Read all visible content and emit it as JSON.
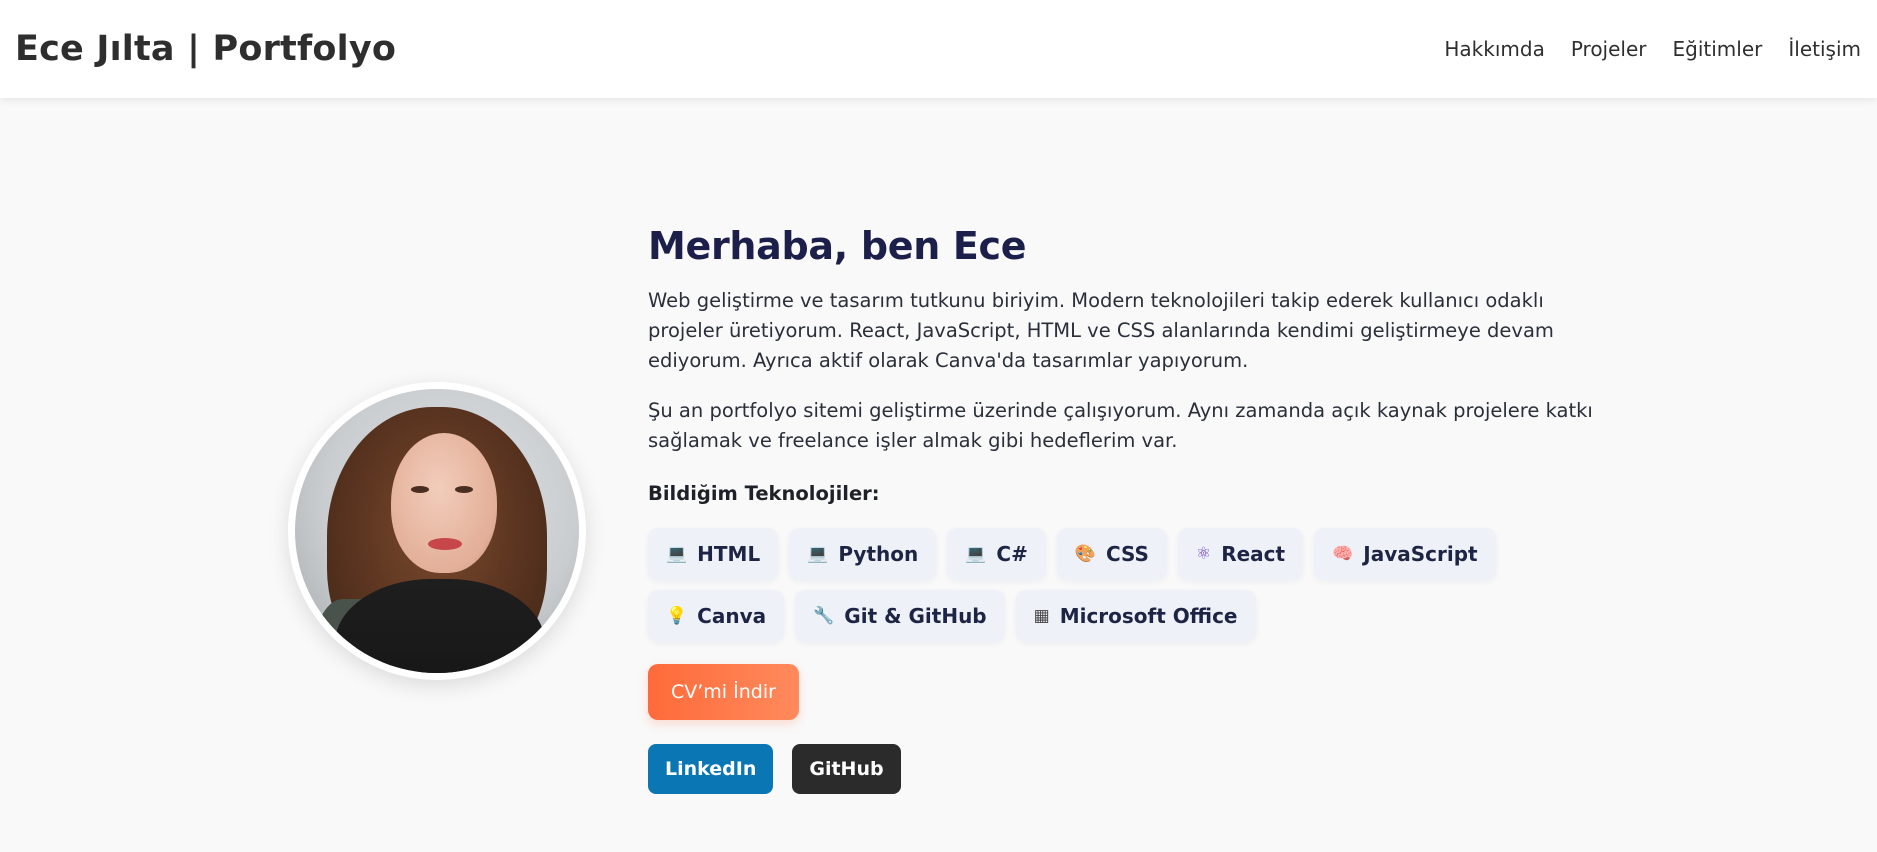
{
  "header": {
    "brand": "Ece Jılta | Portfolyo",
    "nav": [
      "Hakkımda",
      "Projeler",
      "Eğitimler",
      "İletişim"
    ]
  },
  "about": {
    "heading": "Merhaba, ben Ece",
    "paragraph1": "Web geliştirme ve tasarım tutkunu biriyim. Modern teknolojileri takip ederek kullanıcı odaklı projeler üretiyorum. React, JavaScript, HTML ve CSS alanlarında kendimi geliştirmeye devam ediyorum. Ayrıca aktif olarak Canva'da tasarımlar yapıyorum.",
    "paragraph2": "Şu an portfolyo sitemi geliştirme üzerinde çalışıyorum. Aynı zamanda açık kaynak projelere katkı sağlamak ve freelance işler almak gibi hedeflerim var.",
    "tech_title": "Bildiğim Teknolojiler:",
    "technologies": [
      {
        "icon": "💻",
        "icon_name": "laptop-icon",
        "label": "HTML"
      },
      {
        "icon": "💻",
        "icon_name": "laptop-icon",
        "label": "Python"
      },
      {
        "icon": "💻",
        "icon_name": "laptop-icon",
        "label": "C#"
      },
      {
        "icon": "🎨",
        "icon_name": "palette-icon",
        "label": "CSS"
      },
      {
        "icon": "⚛",
        "icon_name": "atom-icon",
        "label": "React"
      },
      {
        "icon": "🧠",
        "icon_name": "brain-icon",
        "label": "JavaScript"
      },
      {
        "icon": "💡",
        "icon_name": "lightbulb-icon",
        "label": "Canva"
      },
      {
        "icon": "🔧",
        "icon_name": "wrench-icon",
        "label": "Git & GitHub"
      },
      {
        "icon": "▦",
        "icon_name": "document-icon",
        "label": "Microsoft Office"
      }
    ],
    "cv_button": "CV’mi İndir",
    "socials": [
      {
        "label": "LinkedIn",
        "color": "#0a76b4"
      },
      {
        "label": "GitHub",
        "color": "#2b2b2b"
      }
    ]
  },
  "colors": {
    "accent": "#ff6a3a",
    "heading": "#1c1f4a",
    "chip_bg": "#eef2f8"
  }
}
